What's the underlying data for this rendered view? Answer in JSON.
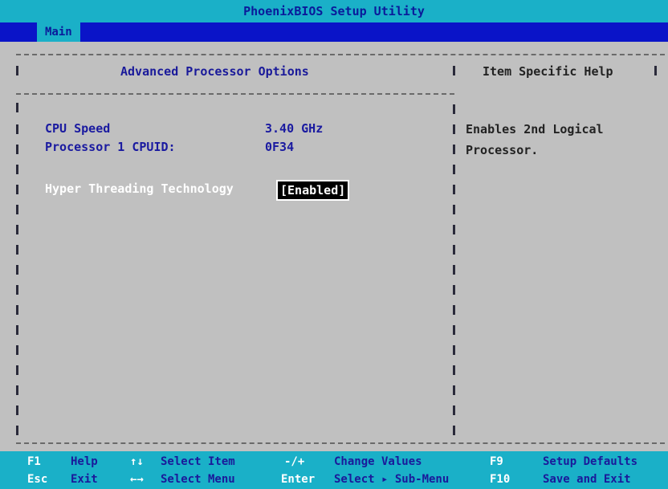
{
  "title": "PhoenixBIOS Setup Utility",
  "menu": {
    "active_tab": "Main"
  },
  "panel": {
    "title": "Advanced Processor Options",
    "help_title": "Item Specific Help",
    "items": [
      {
        "label": "CPU Speed",
        "value": "3.40 GHz"
      },
      {
        "label": "Processor 1 CPUID:",
        "value": "0F34"
      },
      {
        "label": "Hyper Threading Technology",
        "value": "[Enabled]"
      }
    ],
    "help_text": "Enables 2nd Logical\nProcessor."
  },
  "footer": {
    "row1": [
      {
        "key": "F1",
        "desc": "Help"
      },
      {
        "key": "↑↓",
        "desc": "Select Item"
      },
      {
        "key": "-/+",
        "desc": "Change Values"
      },
      {
        "key": "F9",
        "desc": "Setup Defaults"
      }
    ],
    "row2": [
      {
        "key": "Esc",
        "desc": "Exit"
      },
      {
        "key": "←→",
        "desc": "Select Menu"
      },
      {
        "key": "Enter",
        "desc": "Select ▸ Sub-Menu"
      },
      {
        "key": "F10",
        "desc": "Save and Exit"
      }
    ]
  },
  "colors": {
    "title_bg": "#1ab0c8",
    "menu_bg": "#0a14c8",
    "panel_bg": "#c0c0c0",
    "text_blue": "#1a1aa0"
  }
}
